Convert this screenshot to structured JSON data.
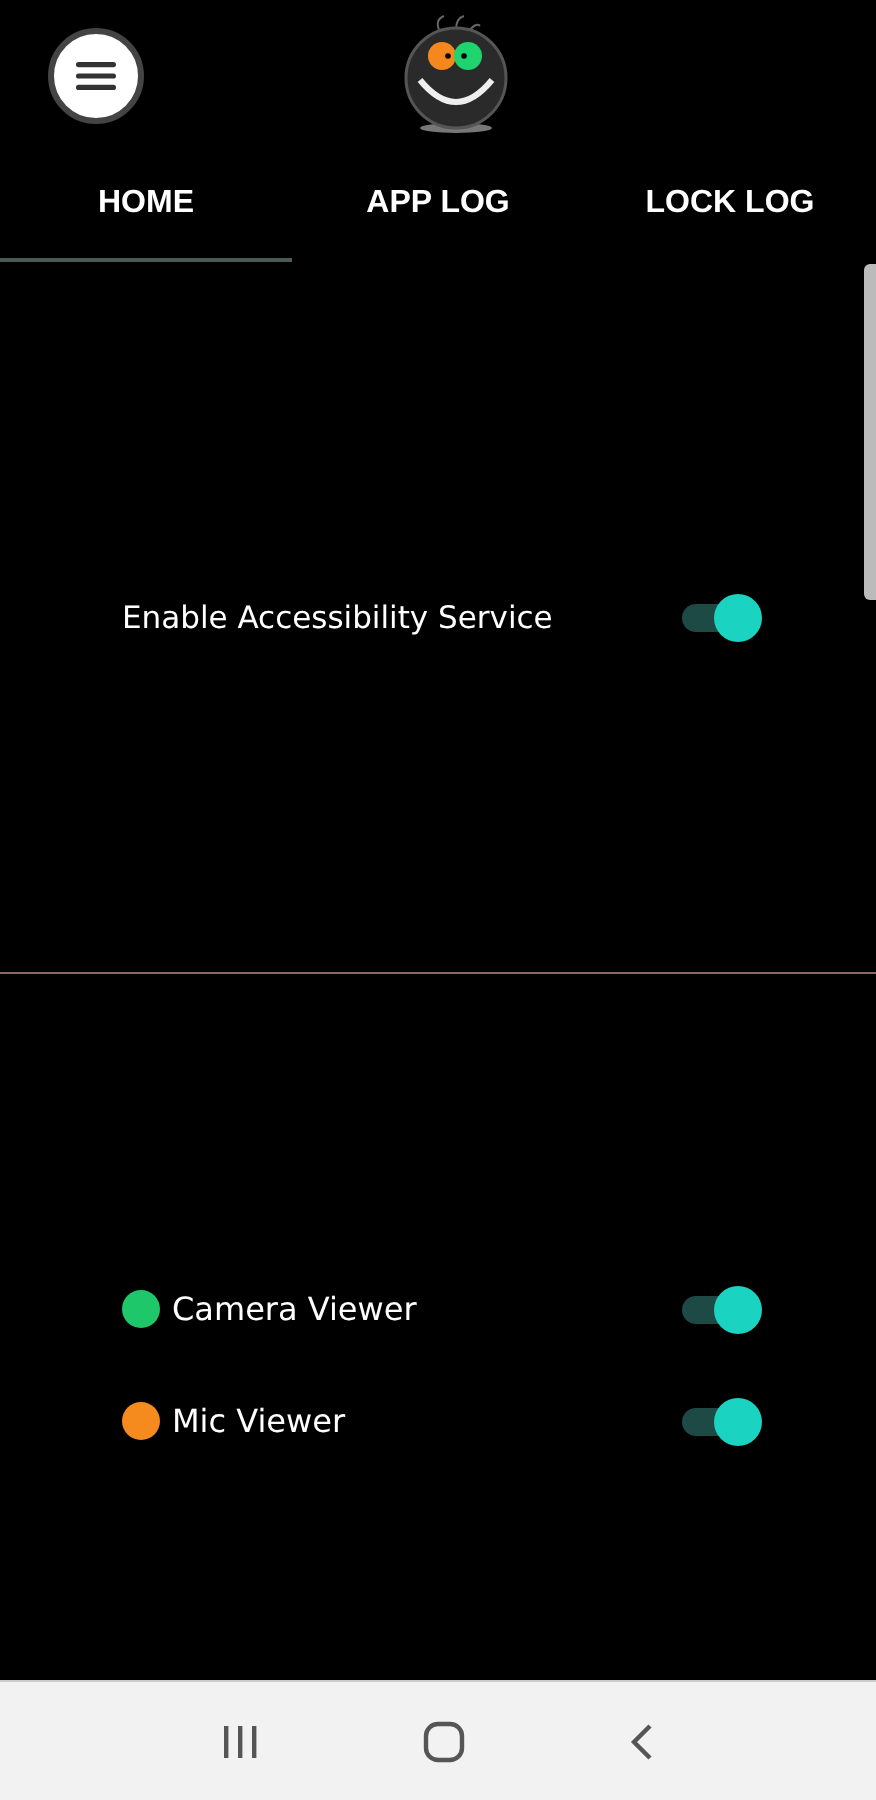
{
  "tabs": [
    {
      "label": "HOME",
      "selected": true
    },
    {
      "label": "APP LOG",
      "selected": false
    },
    {
      "label": "LOCK LOG",
      "selected": false
    }
  ],
  "accessibility": {
    "label": "Enable Accessibility Service",
    "on": true
  },
  "viewers": [
    {
      "label": "Camera Viewer",
      "color": "#1ec86a",
      "on": true
    },
    {
      "label": "Mic Viewer",
      "color": "#f58a1f",
      "on": true
    }
  ]
}
